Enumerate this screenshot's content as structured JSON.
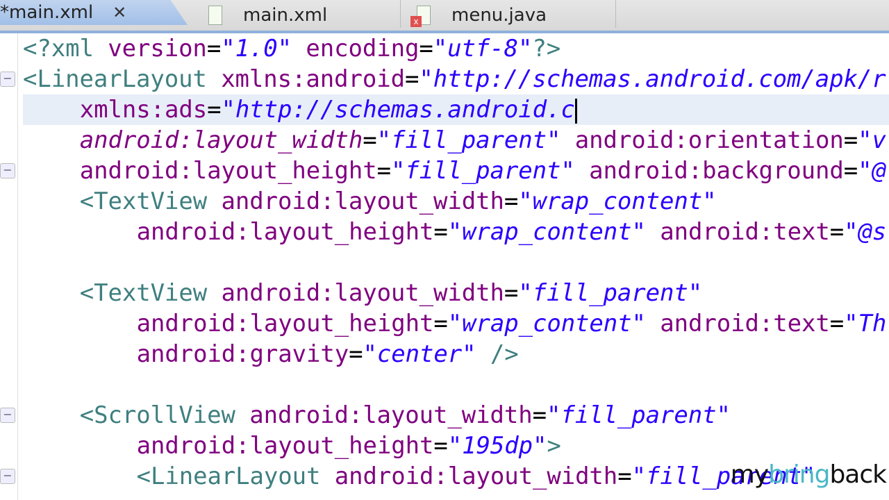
{
  "tabs": [
    {
      "label": "*main.xml",
      "active": true
    },
    {
      "label": "main.xml"
    },
    {
      "label": "menu.java"
    }
  ],
  "close_glyph": "✕",
  "lines": [
    {
      "indent": 0,
      "fold": false,
      "tokens": [
        [
          "pi",
          "<?xml "
        ],
        [
          "attr",
          "version"
        ],
        [
          "eq",
          "="
        ],
        [
          "val",
          "\"1.0\""
        ],
        [
          "eq",
          " "
        ],
        [
          "attr",
          "encoding"
        ],
        [
          "eq",
          "="
        ],
        [
          "val",
          "\"utf-8\""
        ],
        [
          "pi",
          "?>"
        ]
      ]
    },
    {
      "indent": 0,
      "fold": true,
      "tokens": [
        [
          "tag",
          "<LinearLayout "
        ],
        [
          "attr",
          "xmlns:android"
        ],
        [
          "eq",
          "="
        ],
        [
          "val",
          "\"http://schemas.android.com/apk/r"
        ]
      ]
    },
    {
      "indent": 4,
      "fold": false,
      "current": true,
      "tokens": [
        [
          "attr",
          "xmlns:ads"
        ],
        [
          "eq",
          "="
        ],
        [
          "val",
          "\"http://schemas.android.c"
        ]
      ]
    },
    {
      "indent": 4,
      "fold": false,
      "tokens": [
        [
          "attri",
          "android:layout_width"
        ],
        [
          "eq",
          "="
        ],
        [
          "val",
          "\"fill_parent\""
        ],
        [
          "eq",
          " "
        ],
        [
          "attr",
          "android:orientation"
        ],
        [
          "eq",
          "="
        ],
        [
          "val",
          "\"v"
        ]
      ]
    },
    {
      "indent": 4,
      "fold": true,
      "tokens": [
        [
          "attr",
          "android:layout_height"
        ],
        [
          "eq",
          "="
        ],
        [
          "val",
          "\"fill_parent\""
        ],
        [
          "eq",
          " "
        ],
        [
          "attr",
          "android:background"
        ],
        [
          "eq",
          "="
        ],
        [
          "val",
          "\"@"
        ]
      ]
    },
    {
      "indent": 4,
      "fold": false,
      "tokens": [
        [
          "tag",
          "<TextView "
        ],
        [
          "attr",
          "android:layout_width"
        ],
        [
          "eq",
          "="
        ],
        [
          "val",
          "\"wrap_content\""
        ]
      ]
    },
    {
      "indent": 8,
      "fold": false,
      "tokens": [
        [
          "attr",
          "android:layout_height"
        ],
        [
          "eq",
          "="
        ],
        [
          "val",
          "\"wrap_content\""
        ],
        [
          "eq",
          " "
        ],
        [
          "attr",
          "android:text"
        ],
        [
          "eq",
          "="
        ],
        [
          "val",
          "\"@s"
        ]
      ]
    },
    {
      "indent": 0,
      "fold": false,
      "tokens": []
    },
    {
      "indent": 4,
      "fold": false,
      "tokens": [
        [
          "tag",
          "<TextView "
        ],
        [
          "attr",
          "android:layout_width"
        ],
        [
          "eq",
          "="
        ],
        [
          "val",
          "\"fill_parent\""
        ]
      ]
    },
    {
      "indent": 8,
      "fold": false,
      "tokens": [
        [
          "attr",
          "android:layout_height"
        ],
        [
          "eq",
          "="
        ],
        [
          "val",
          "\"wrap_content\""
        ],
        [
          "eq",
          " "
        ],
        [
          "attr",
          "android:text"
        ],
        [
          "eq",
          "="
        ],
        [
          "val",
          "\"Th"
        ]
      ]
    },
    {
      "indent": 8,
      "fold": false,
      "tokens": [
        [
          "attr",
          "android:gravity"
        ],
        [
          "eq",
          "="
        ],
        [
          "val",
          "\"center\""
        ],
        [
          "eq",
          " "
        ],
        [
          "tag",
          "/>"
        ]
      ]
    },
    {
      "indent": 0,
      "fold": false,
      "tokens": []
    },
    {
      "indent": 4,
      "fold": true,
      "tokens": [
        [
          "tag",
          "<ScrollView "
        ],
        [
          "attr",
          "android:layout_width"
        ],
        [
          "eq",
          "="
        ],
        [
          "val",
          "\"fill_parent\""
        ]
      ]
    },
    {
      "indent": 8,
      "fold": false,
      "tokens": [
        [
          "attr",
          "android:layout_height"
        ],
        [
          "eq",
          "="
        ],
        [
          "val",
          "\"195dp\""
        ],
        [
          "tag",
          ">"
        ]
      ]
    },
    {
      "indent": 8,
      "fold": true,
      "tokens": [
        [
          "tag",
          "<LinearLayout "
        ],
        [
          "attr",
          "android:layout_width"
        ],
        [
          "eq",
          "="
        ],
        [
          "val",
          "\"fill_parent\""
        ]
      ]
    }
  ],
  "watermark": {
    "part1": "my",
    "part2": "bring",
    "part3": "back"
  },
  "colors": {
    "tag": "#3f7f7f",
    "attr": "#7f007f",
    "val": "#2a00ff",
    "current_line": "#e8eef8"
  }
}
